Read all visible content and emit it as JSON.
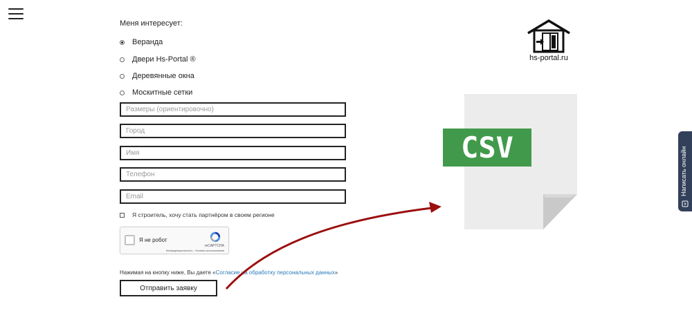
{
  "menu": {
    "icon": "hamburger-menu-icon"
  },
  "form": {
    "title": "Меня интересует:",
    "options": [
      {
        "label": "Веранда",
        "checked": true
      },
      {
        "label": "Двери Hs-Portal ®",
        "checked": false
      },
      {
        "label": "Деревянные окна",
        "checked": false
      },
      {
        "label": "Москитные сетки",
        "checked": false
      }
    ],
    "fields": {
      "size_placeholder": "Размеры (ориентировочно)",
      "city_placeholder": "Город",
      "name_placeholder": "Имя",
      "phone_placeholder": "Телефон",
      "email_placeholder": "Email"
    },
    "partner_checkbox": {
      "label": "Я строитель, хочу стать партнёром в своем регионе",
      "checked": false
    },
    "captcha": {
      "label": "Я не робот",
      "brand": "reCAPTCHA",
      "links": "Конфиденциальность - Условия использования"
    },
    "consent": {
      "prefix": "Нажимая на кнопку ниже, Вы даете «",
      "link": "Согласие на обработку персональных данных",
      "suffix": "»"
    },
    "submit_label": "Отправить заявку"
  },
  "logo": {
    "text": "hs-portal.ru",
    "icon": "house-door-logo-icon"
  },
  "csv": {
    "text": "CSV",
    "icon": "csv-file-icon"
  },
  "chat": {
    "label": "Написать онлайн",
    "icon": "chat-icon"
  },
  "colors": {
    "csv_green": "#419a4b",
    "arrow_red": "#9b0f0f",
    "chat_bg": "#33405a",
    "link_blue": "#2a7ab8"
  }
}
